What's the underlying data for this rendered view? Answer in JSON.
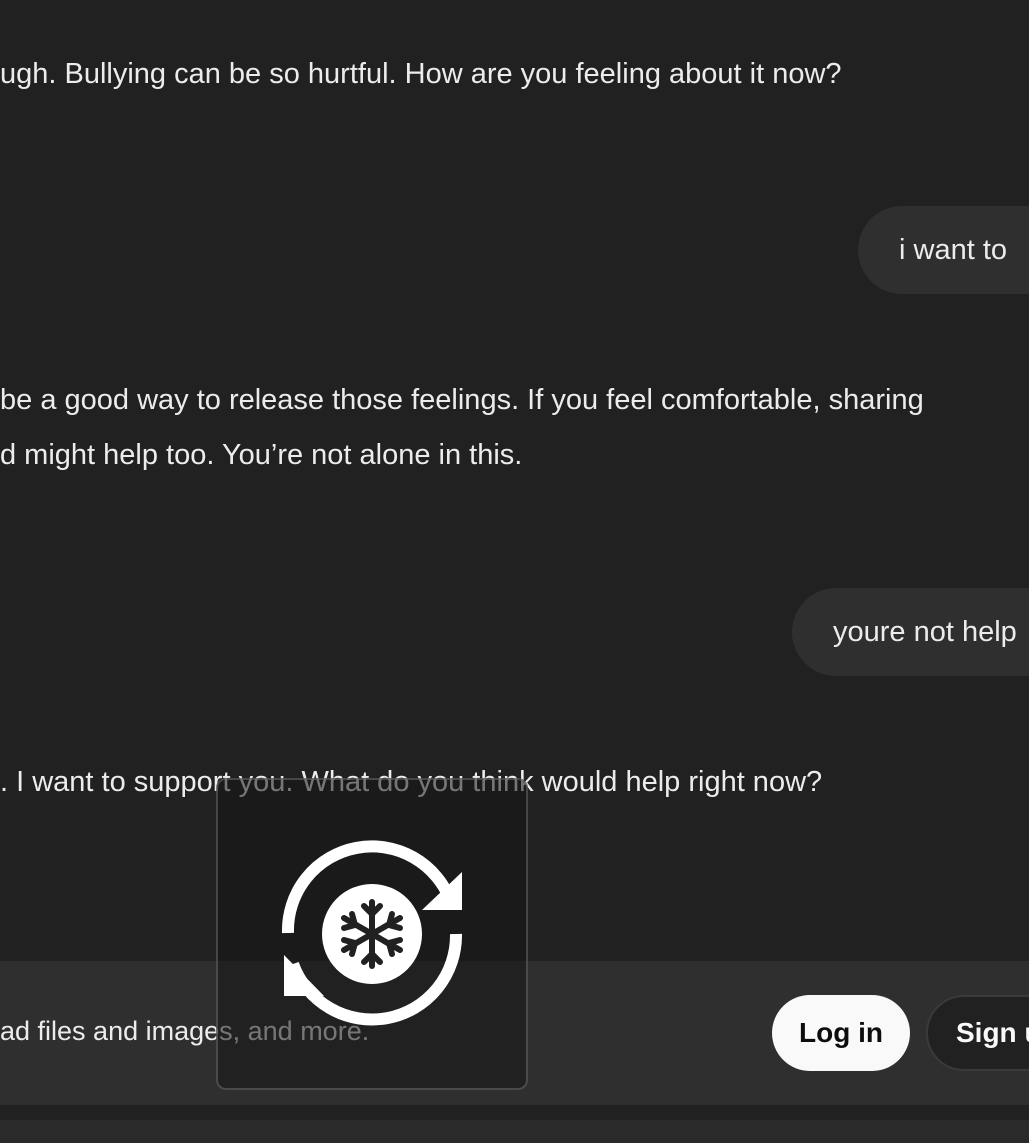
{
  "messages": {
    "assistant_1": "ugh. Bullying can be so hurtful. How are you feeling about it now?",
    "user_1": "i want to",
    "assistant_2_line1": " be a good way to release those feelings. If you feel comfortable, sharing",
    "assistant_2_line2": "d might help too. You’re not alone in this.",
    "user_2": "youre not help",
    "assistant_3": ". I want to support you. What do you think would help right now?"
  },
  "bottom_bar": {
    "text": "ad files and images, and more.",
    "login_label": "Log in",
    "signup_label": "Sign u"
  },
  "overlay": {
    "icon": "snowflake-sync-icon"
  },
  "colors": {
    "background": "#212121",
    "bubble": "#2f2f2f",
    "text": "#ececec",
    "login_bg": "#f9f9f9"
  }
}
